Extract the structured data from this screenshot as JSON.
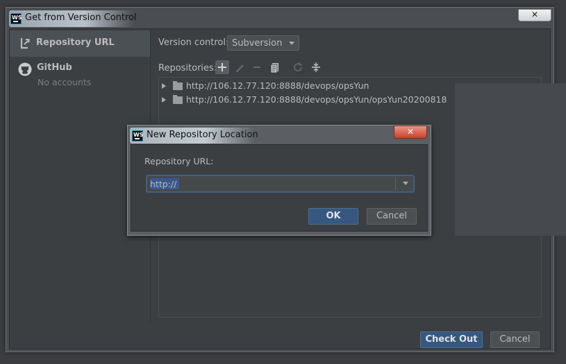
{
  "window": {
    "title": "Get from Version Control",
    "close_glyph": "✕"
  },
  "sidebar": {
    "items": [
      {
        "label": "Repository URL",
        "icon": "vcs-arrow-icon"
      },
      {
        "label": "GitHub",
        "sublabel": "No accounts",
        "icon": "github-icon"
      }
    ]
  },
  "main": {
    "version_control_label": "Version control:",
    "version_control_value": "Subversion",
    "repositories_label": "Repositories:",
    "toolbar": [
      "add-icon",
      "edit-icon",
      "remove-icon",
      "browse-icon",
      "refresh-icon",
      "collapse-icon"
    ],
    "repositories": [
      "http://106.12.77.120:8888/devops/opsYun",
      "http://106.12.77.120:8888/devops/opsYun/opsYun20200818"
    ]
  },
  "footer": {
    "checkout_label": "Check Out",
    "cancel_label": "Cancel"
  },
  "dialog": {
    "title": "New Repository Location",
    "close_glyph": "✕",
    "url_label": "Repository URL:",
    "url_value": "http://",
    "ok_label": "OK",
    "cancel_label": "Cancel"
  },
  "colors": {
    "window_bg": "#3c3f41",
    "selection": "#4b5054",
    "primary_button": "#365880",
    "focus_border": "#3d6185"
  }
}
